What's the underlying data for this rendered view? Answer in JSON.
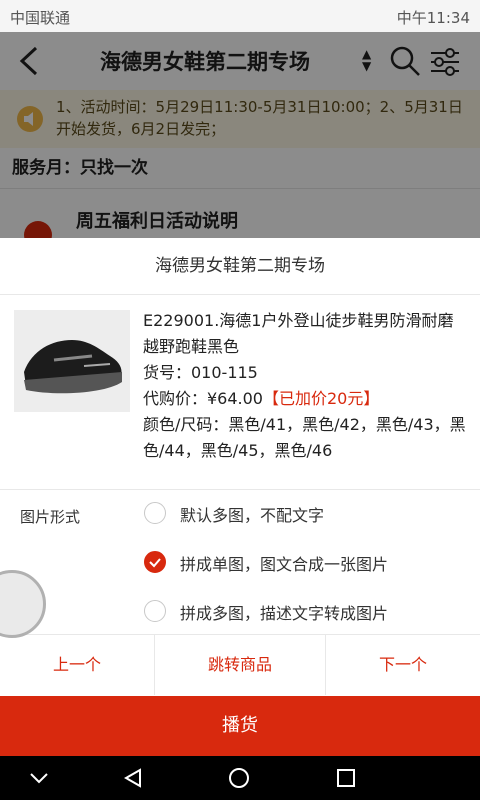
{
  "status": {
    "carrier": "中国联通",
    "time": "中午11:34"
  },
  "nav": {
    "title": "海德男女鞋第二期专场",
    "sort_glyph": "▲▼"
  },
  "notice": {
    "text": "1、活动时间：5月29日11:30-5月31日10:00；2、5月31日开始发货，6月2日发完；"
  },
  "service": {
    "text": "服务月：只找一次"
  },
  "friday": {
    "text": "周五福利日活动说明"
  },
  "sheet": {
    "title": "海德男女鞋第二期专场",
    "product": {
      "name": "E229001.海德1户外登山徒步鞋男防滑耐磨越野跑鞋黑色",
      "sku": "货号：010-115",
      "price_label": "代购价：¥64.00",
      "price_note": "【已加价20元】",
      "variants": "颜色/尺码：黑色/41，黑色/42，黑色/43，黑色/44，黑色/45，黑色/46"
    },
    "image_mode": {
      "label": "图片形式",
      "options": [
        {
          "label": "默认多图，不配文字",
          "selected": false
        },
        {
          "label": "拼成单图，图文合成一张图片",
          "selected": true
        },
        {
          "label": "拼成多图，描述文字转成图片",
          "selected": false
        }
      ]
    },
    "buttons": {
      "prev": "上一个",
      "goto": "跳转商品",
      "next": "下一个"
    },
    "cta": "播货"
  },
  "colors": {
    "accent": "#d8290e",
    "notice_bg": "#fbf6e3"
  }
}
